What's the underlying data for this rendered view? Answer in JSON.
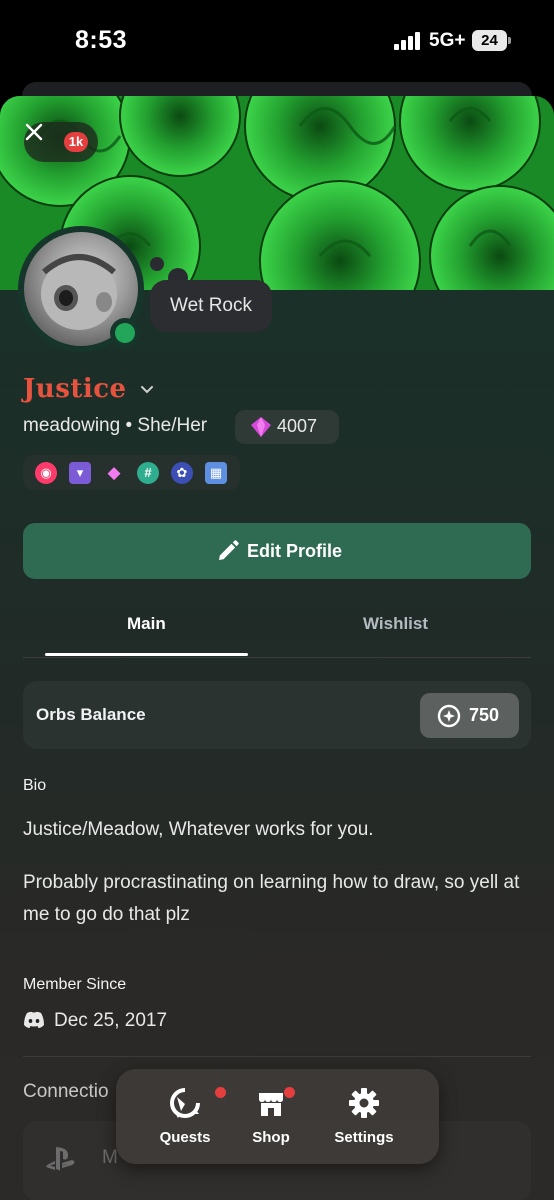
{
  "status_bar": {
    "time": "8:53",
    "network": "5G+",
    "battery": "24"
  },
  "header": {
    "close_icon": "close-icon",
    "notification_count": "1k"
  },
  "banner": {
    "description_color": "#2fb33e"
  },
  "profile": {
    "custom_status": "Wet Rock",
    "display_name": "Justice",
    "display_name_color": "#e8533f",
    "username": "meadowing",
    "separator": "•",
    "pronouns": "She/Her",
    "nitro_tag": "4007",
    "badges": [
      "nitro-badge",
      "hypesquad-badge",
      "gem-badge",
      "hashtag-badge",
      "wreath-badge",
      "gift-badge"
    ]
  },
  "actions": {
    "edit_profile": "Edit Profile"
  },
  "tabs": [
    {
      "label": "Main",
      "active": true
    },
    {
      "label": "Wishlist",
      "active": false
    }
  ],
  "orbs": {
    "label": "Orbs Balance",
    "value": "750"
  },
  "bio": {
    "label": "Bio",
    "line1": "Justice/Meadow, Whatever works for you.",
    "line2": "Probably procrastinating on learning how to draw, so yell at me to go do that plz"
  },
  "member_since": {
    "label": "Member Since",
    "date": "Dec 25, 2017"
  },
  "connections": {
    "label": "Connectio",
    "items": [
      {
        "service": "playstation",
        "name": "M"
      }
    ]
  },
  "bottom_nav": [
    {
      "label": "Quests",
      "icon": "quests-icon",
      "has_dot": true
    },
    {
      "label": "Shop",
      "icon": "shop-icon",
      "has_dot": true
    },
    {
      "label": "Settings",
      "icon": "gear-icon",
      "has_dot": false
    }
  ],
  "colors": {
    "accent_green": "#2f6b52",
    "online": "#23a55a",
    "notification_red": "#e53e3e"
  }
}
